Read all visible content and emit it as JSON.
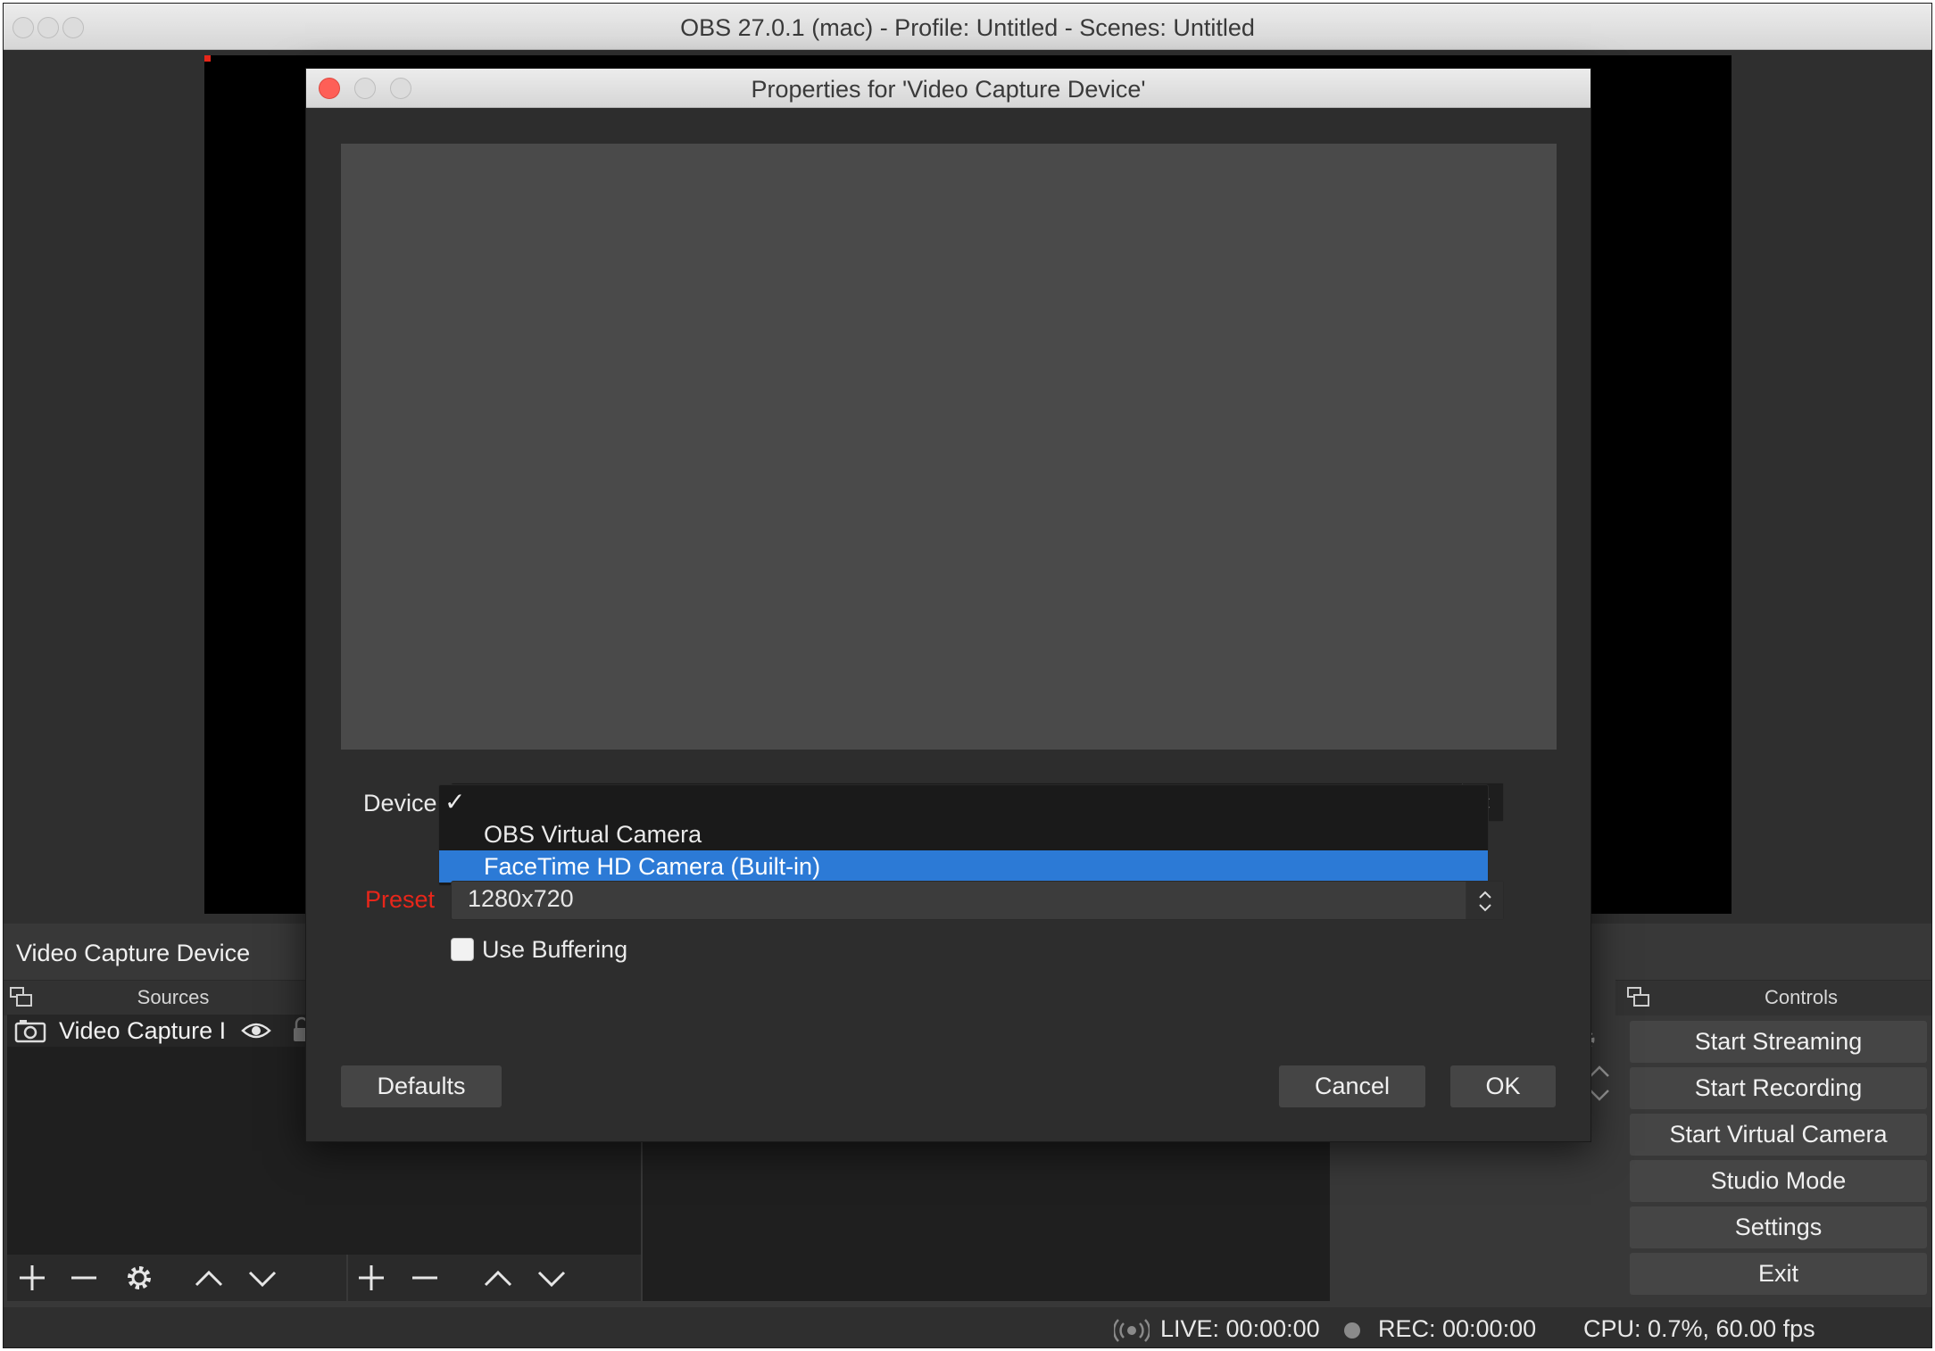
{
  "main_window": {
    "title": "OBS 27.0.1 (mac) - Profile: Untitled - Scenes: Untitled"
  },
  "dialog": {
    "title": "Properties for 'Video Capture Device'",
    "device_label": "Device",
    "device_dropdown": {
      "checkmark": "✓",
      "options": [
        "OBS Virtual Camera",
        "FaceTime HD Camera (Built-in)"
      ],
      "highlighted": "FaceTime HD Camera (Built-in)"
    },
    "preset_label": "Preset",
    "preset_value": "1280x720",
    "use_buffering_label": "Use Buffering",
    "use_buffering_checked": false,
    "defaults_label": "Defaults",
    "cancel_label": "Cancel",
    "ok_label": "OK"
  },
  "docks": {
    "current_source_title": "Video Capture Device",
    "sources_header": "Sources",
    "source_row_name": "Video Capture I",
    "controls_header": "Controls",
    "controls": {
      "start_streaming": "Start Streaming",
      "start_recording": "Start Recording",
      "start_virtual_camera": "Start Virtual Camera",
      "studio_mode": "Studio Mode",
      "settings": "Settings",
      "exit": "Exit"
    }
  },
  "status_bar": {
    "live": "LIVE: 00:00:00",
    "rec": "REC: 00:00:00",
    "cpu": "CPU: 0.7%, 60.00 fps"
  },
  "colors": {
    "highlight": "#2c7ad6",
    "preset_label": "#e8261a",
    "close_button": "#fe5f57"
  },
  "icons": [
    "camera-icon",
    "eye-icon",
    "lock-icon",
    "plus-icon",
    "minus-icon",
    "gear-icon",
    "chevron-up-icon",
    "chevron-down-icon",
    "broadcast-icon",
    "record-dot-icon",
    "dock-popout-icon"
  ]
}
